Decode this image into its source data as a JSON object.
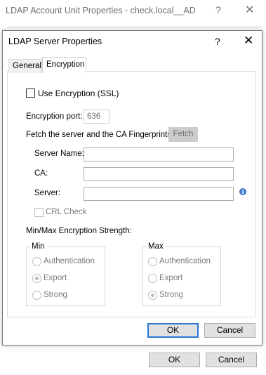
{
  "parent_dialog": {
    "title": "LDAP Account Unit Properties - check.local__AD",
    "help_glyph": "?",
    "close_glyph": "✕",
    "ok_label": "OK",
    "cancel_label": "Cancel"
  },
  "dialog": {
    "title": "LDAP Server Properties",
    "help_glyph": "?",
    "close_glyph": "✕",
    "tabs": [
      {
        "label": "General",
        "active": false
      },
      {
        "label": "Encryption",
        "active": true
      }
    ],
    "use_encryption": {
      "label": "Use Encryption (SSL)",
      "checked": false
    },
    "encryption_port": {
      "label": "Encryption port:",
      "value": "636"
    },
    "fetch": {
      "label": "Fetch the server and the CA Fingerprints:",
      "button_label": "Fetch"
    },
    "fields": {
      "server_name": {
        "label": "Server Name:",
        "value": ""
      },
      "ca": {
        "label": "CA:",
        "value": ""
      },
      "server": {
        "label": "Server:",
        "value": ""
      }
    },
    "info_icon": "info-icon",
    "crl_check": {
      "label": "CRL Check",
      "checked": false
    },
    "strength_label": "Min/Max Encryption Strength:",
    "min_group": {
      "title": "Min",
      "options": [
        "Authentication",
        "Export",
        "Strong"
      ],
      "selected": "Export"
    },
    "max_group": {
      "title": "Max",
      "options": [
        "Authentication",
        "Export",
        "Strong"
      ],
      "selected": "Strong"
    },
    "ok_label": "OK",
    "cancel_label": "Cancel"
  },
  "colors": {
    "accent": "#2a77d6",
    "info": "#3a78c9",
    "disabled_text": "#7a7a7a"
  }
}
